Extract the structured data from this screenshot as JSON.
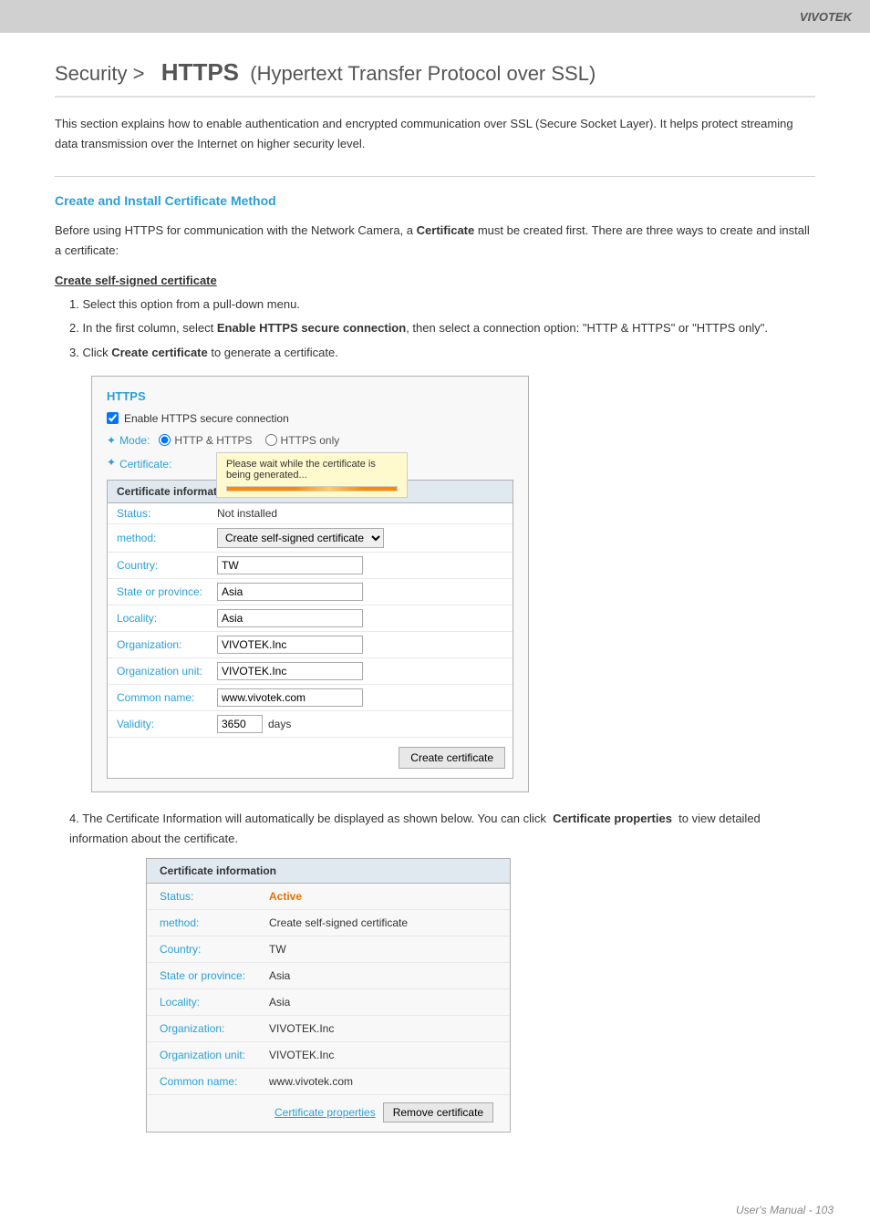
{
  "header": {
    "brand": "VIVOTEK"
  },
  "page_title": {
    "prefix": "Security >",
    "main": "HTTPS",
    "subtitle": "(Hypertext Transfer Protocol over SSL)"
  },
  "intro": {
    "text": "This section explains how to enable authentication and encrypted communication over SSL (Secure Socket Layer). It helps protect streaming data transmission over the Internet on higher security level."
  },
  "section_heading": "Create and Install Certificate Method",
  "before_text": "Before using HTTPS for communication with the Network Camera, a Certificate must be created first. There are three ways to create and install a certificate:",
  "subsection": "Create self-signed certificate",
  "steps": [
    "1. Select this option from a pull-down menu.",
    "2. In the first column, select Enable HTTPS secure connection, then select a connection option: \"HTTP & HTTPS\" or \"HTTPS only\".",
    "3. Click Create certificate to generate a certificate."
  ],
  "https_panel": {
    "title": "HTTPS",
    "enable_label": "Enable HTTPS secure connection",
    "mode_label": "Mode:",
    "http_https_label": "HTTP & HTTPS",
    "https_only_label": "HTTPS only",
    "cert_label": "Certificate:",
    "tooltip_text": "Please wait while the certificate is being generated...",
    "cert_info_header": "Certificate information",
    "status_label": "Status:",
    "status_value": "Not installed",
    "method_label": "method:",
    "method_value": "Create self-signed certificate",
    "country_label": "Country:",
    "country_value": "TW",
    "state_label": "State or province:",
    "state_value": "Asia",
    "locality_label": "Locality:",
    "locality_value": "Asia",
    "org_label": "Organization:",
    "org_value": "VIVOTEK.Inc",
    "org_unit_label": "Organization unit:",
    "org_unit_value": "VIVOTEK.Inc",
    "common_name_label": "Common name:",
    "common_name_value": "www.vivotek.com",
    "validity_label": "Validity:",
    "validity_value": "3650",
    "validity_unit": "days",
    "create_btn": "Create certificate"
  },
  "step4": {
    "text_before": "4. The Certificate Information will automatically be displayed as shown below. You can click",
    "link_text": "Certificate properties",
    "text_after": "to view detailed information about the certificate."
  },
  "cert_panel2": {
    "header": "Certificate information",
    "status_label": "Status:",
    "status_value": "Active",
    "method_label": "method:",
    "method_value": "Create self-signed certificate",
    "country_label": "Country:",
    "country_value": "TW",
    "state_label": "State or province:",
    "state_value": "Asia",
    "locality_label": "Locality:",
    "locality_value": "Asia",
    "org_label": "Organization:",
    "org_value": "VIVOTEK.Inc",
    "org_unit_label": "Organization unit:",
    "org_unit_value": "VIVOTEK.Inc",
    "common_name_label": "Common name:",
    "common_name_value": "www.vivotek.com",
    "cert_props_link": "Certificate properties",
    "remove_btn": "Remove certificate"
  },
  "footer": {
    "text": "User's Manual - 103"
  }
}
